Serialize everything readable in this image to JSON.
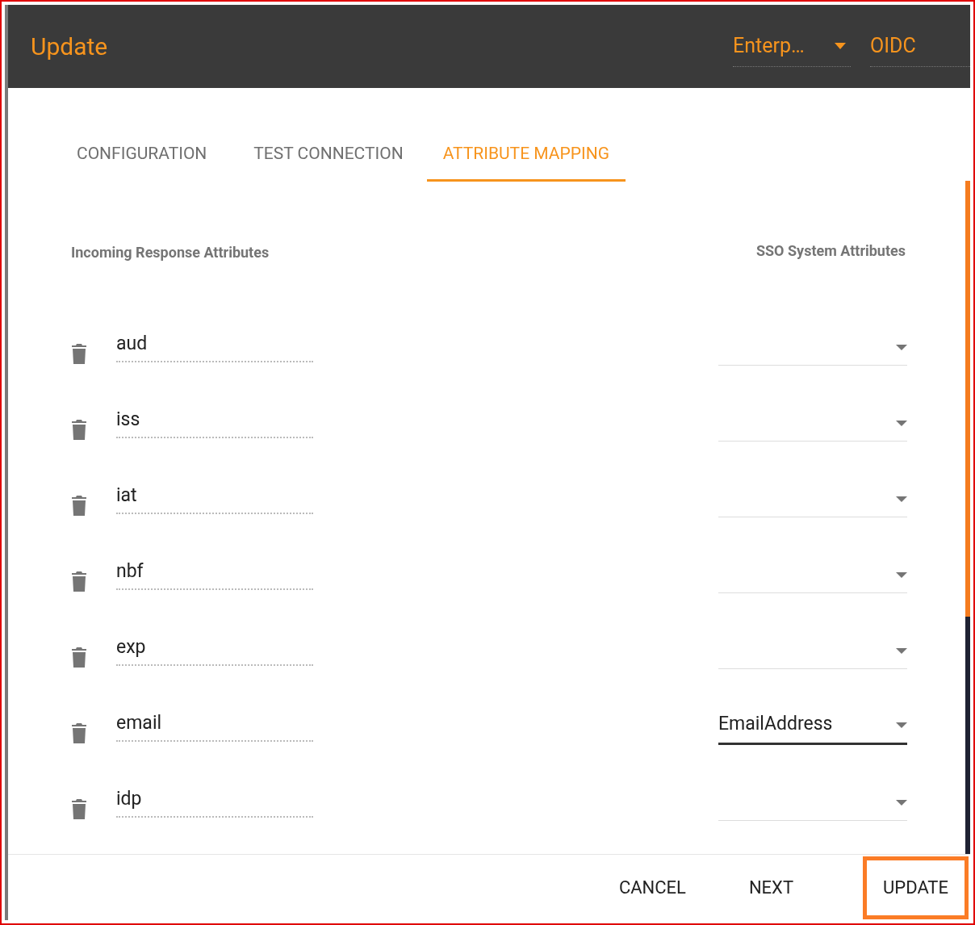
{
  "header": {
    "title": "Update",
    "dropdown": {
      "value": "Enterp…"
    },
    "field": {
      "value": "OIDC"
    }
  },
  "tabs": [
    {
      "label": "CONFIGURATION",
      "selected": false
    },
    {
      "label": "TEST CONNECTION",
      "selected": false
    },
    {
      "label": "ATTRIBUTE MAPPING",
      "selected": true
    }
  ],
  "columns": {
    "incoming": "Incoming Response Attributes",
    "system": "SSO System Attributes"
  },
  "rows": [
    {
      "attribute": "aud",
      "focused": false
    },
    {
      "attribute": "iss",
      "focused": false
    },
    {
      "attribute": "iat",
      "focused": false
    },
    {
      "attribute": "nbf",
      "focused": false
    },
    {
      "attribute": "exp",
      "focused": false
    },
    {
      "attribute": "email",
      "mapped": "EmailAddress",
      "focused": true
    },
    {
      "attribute": "idp",
      "focused": false
    }
  ],
  "buttons": [
    {
      "label": "CANCEL",
      "highlighted": false
    },
    {
      "label": "NEXT",
      "highlighted": false
    },
    {
      "label": "UPDATE",
      "highlighted": true
    }
  ]
}
